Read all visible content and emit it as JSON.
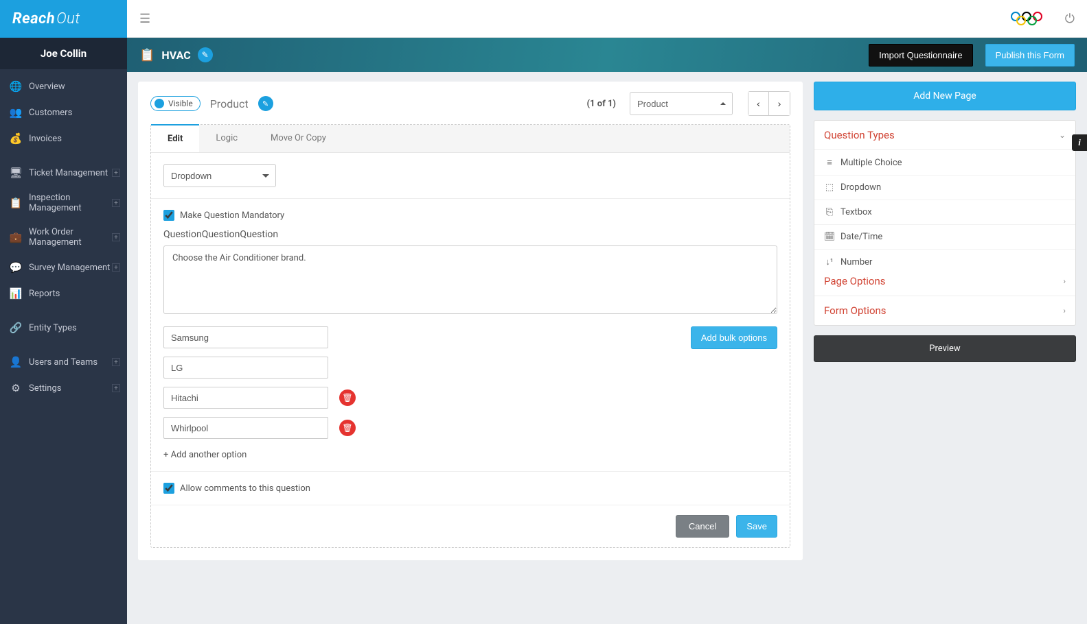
{
  "brand": {
    "name_main": "Reach",
    "name_sub": "Out"
  },
  "user": {
    "name": "Joe Collin"
  },
  "sidebar": {
    "items": [
      {
        "icon": "🌐",
        "label": "Overview",
        "expandable": false
      },
      {
        "icon": "👥",
        "label": "Customers",
        "expandable": false
      },
      {
        "icon": "💰",
        "label": "Invoices",
        "expandable": false
      }
    ],
    "items2": [
      {
        "icon": "🖥",
        "label": "Ticket Management",
        "expandable": true
      },
      {
        "icon": "📋",
        "label": "Inspection Management",
        "expandable": true
      },
      {
        "icon": "💼",
        "label": "Work Order Management",
        "expandable": true
      },
      {
        "icon": "💬",
        "label": "Survey Management",
        "expandable": true
      },
      {
        "icon": "📊",
        "label": "Reports",
        "expandable": false
      }
    ],
    "items3": [
      {
        "icon": "🔗",
        "label": "Entity Types",
        "expandable": false
      }
    ],
    "items4": [
      {
        "icon": "👤",
        "label": "Users and Teams",
        "expandable": true
      },
      {
        "icon": "⚙",
        "label": "Settings",
        "expandable": true
      }
    ]
  },
  "banner": {
    "title": "HVAC",
    "import_label": "Import Questionnaire",
    "publish_label": "Publish this Form"
  },
  "page": {
    "visible_label": "Visible",
    "name": "Product",
    "counter": "(1 of 1)",
    "selector_value": "Product",
    "add_page_label": "Add New Page"
  },
  "tabs": {
    "edit": "Edit",
    "logic": "Logic",
    "move": "Move Or Copy"
  },
  "question": {
    "type_value": "Dropdown",
    "mandatory_label": "Make Question Mandatory",
    "mandatory_checked": true,
    "section_title": "QuestionQuestionQuestion",
    "text": "Choose the Air Conditioner brand.",
    "options": [
      {
        "value": "Samsung",
        "deletable": false
      },
      {
        "value": "LG",
        "deletable": false
      },
      {
        "value": "Hitachi",
        "deletable": true
      },
      {
        "value": "Whirlpool",
        "deletable": true
      }
    ],
    "add_another_label": "+ Add another option",
    "bulk_label": "Add bulk options",
    "allow_comments_label": "Allow comments to this question",
    "allow_comments_checked": true
  },
  "footer": {
    "cancel": "Cancel",
    "save": "Save"
  },
  "right": {
    "qtypes_title": "Question Types",
    "qtypes": [
      {
        "icon": "≡",
        "label": "Multiple Choice"
      },
      {
        "icon": "⬚",
        "label": "Dropdown"
      },
      {
        "icon": "⎘",
        "label": "Textbox"
      },
      {
        "icon": "🗓",
        "label": "Date/Time"
      },
      {
        "icon": "↓¹",
        "label": "Number"
      }
    ],
    "page_options_title": "Page Options",
    "form_options_title": "Form Options",
    "preview_label": "Preview"
  }
}
